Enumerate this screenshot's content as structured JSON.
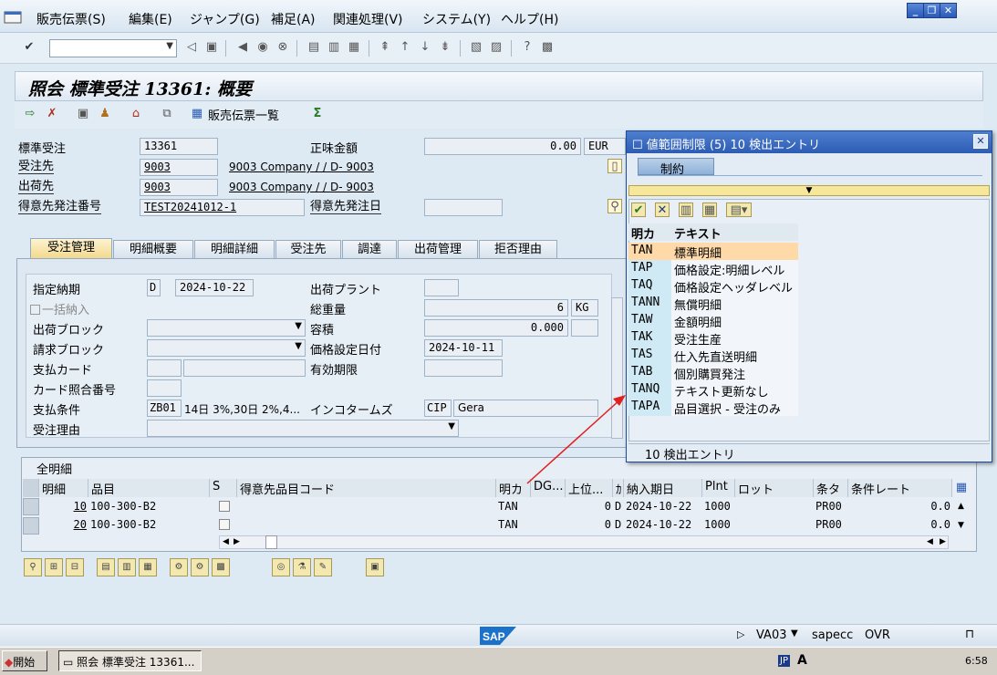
{
  "menu": [
    "販売伝票(S)",
    "編集(E)",
    "ジャンプ(G)",
    "補足(A)",
    "関連処理(V)",
    "システム(Y)",
    "ヘルプ(H)"
  ],
  "title": "照会 標準受注 13361: 概要",
  "app_toolbar": {
    "doc_list_label": "販売伝票一覧"
  },
  "header": {
    "order_type_label": "標準受注",
    "order_no": "13361",
    "net_value_label": "正味金額",
    "net_value": "0.00",
    "currency": "EUR",
    "sold_to_label": "受注先",
    "sold_to": "9003",
    "sold_to_name": "9003 Company / / D- 9003",
    "ship_to_label": "出荷先",
    "ship_to": "9003",
    "ship_to_name": "9003 Company / / D- 9003",
    "po_label": "得意先発注番号",
    "po": "TEST20241012-1",
    "po_date_label": "得意先発注日"
  },
  "tabs": [
    "受注管理",
    "明細概要",
    "明細詳細",
    "受注先",
    "調達",
    "出荷管理",
    "拒否理由"
  ],
  "form": {
    "req_date_label": "指定納期",
    "req_date_type": "D",
    "req_date": "2024-10-22",
    "plant_label": "出荷プラント",
    "complete_label": "一括納入",
    "weight_label": "総重量",
    "weight": "6",
    "weight_unit": "KG",
    "delivery_block_label": "出荷ブロック",
    "volume_label": "容積",
    "volume": "0.000",
    "billing_block_label": "請求ブロック",
    "pricing_date_label": "価格設定日付",
    "pricing_date": "2024-10-11",
    "card_label": "支払カード",
    "valid_label": "有効期限",
    "card_check_label": "カード照合番号",
    "pay_terms_label": "支払条件",
    "pay_terms": "ZB01",
    "pay_terms_text": "14日 3%,30日 2%,4...",
    "incoterms_label": "インコタームズ",
    "incoterms": "CIP",
    "incoterms_text": "Gera",
    "order_reason_label": "受注理由"
  },
  "items": {
    "section_label": "全明細",
    "columns": [
      "明細",
      "品目",
      "S",
      "得意先品目コード",
      "明カ",
      "DG...",
      "上位...",
      "ｶ",
      "納入期日",
      "Plnt",
      "ロット",
      "条タ",
      "条件レート"
    ],
    "rows": [
      {
        "item": "10",
        "material": "100-300-B2",
        "cat": "TAN",
        "qty": "0",
        "unit": "D",
        "date": "2024-10-22",
        "plant": "1000",
        "cond": "PR00",
        "rate": "0.0"
      },
      {
        "item": "20",
        "material": "100-300-B2",
        "cat": "TAN",
        "qty": "0",
        "unit": "D",
        "date": "2024-10-22",
        "plant": "1000",
        "cond": "PR00",
        "rate": "0.0"
      }
    ]
  },
  "popup": {
    "title": "値範囲制限 (5)  10 検出エントリ",
    "tab": "制約",
    "col_key": "明カ",
    "col_text": "テキスト",
    "entries": [
      {
        "key": "TAN",
        "text": "標準明細"
      },
      {
        "key": "TAP",
        "text": "価格設定:明細レベル"
      },
      {
        "key": "TAQ",
        "text": "価格設定ヘッダレベル"
      },
      {
        "key": "TANN",
        "text": "無償明細"
      },
      {
        "key": "TAW",
        "text": "金額明細"
      },
      {
        "key": "TAK",
        "text": "受注生産"
      },
      {
        "key": "TAS",
        "text": "仕入先直送明細"
      },
      {
        "key": "TAB",
        "text": "個別購買発注"
      },
      {
        "key": "TANQ",
        "text": "テキスト更新なし"
      },
      {
        "key": "TAPA",
        "text": "品目選択 - 受注のみ"
      }
    ],
    "footer": "10 検出エントリ"
  },
  "status": {
    "tcode": "VA03",
    "server": "sapecc",
    "mode": "OVR"
  },
  "taskbar": {
    "start": "開始",
    "task": "照会 標準受注 13361...",
    "ime": "JP",
    "time": "6:58"
  },
  "colors": {
    "accent": "#2d5cb4",
    "selected_row": "#ffd9a8",
    "active_tab": "#f2d98e"
  }
}
